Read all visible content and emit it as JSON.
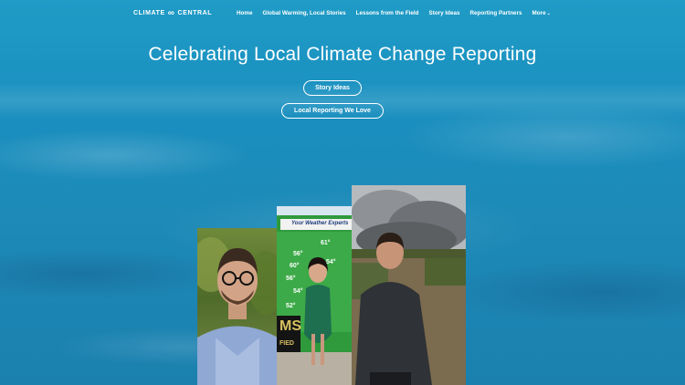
{
  "nav": {
    "logo": "CLIMATE",
    "logo_mark": "∞",
    "logo_2": "CENTRAL",
    "items": [
      {
        "label": "Home"
      },
      {
        "label": "Global Warming, Local Stories"
      },
      {
        "label": "Lessons from the Field"
      },
      {
        "label": "Story Ideas"
      },
      {
        "label": "Reporting Partners"
      },
      {
        "label": "More"
      }
    ]
  },
  "hero": {
    "title": "Celebrating Local Climate Change Reporting",
    "button_story_ideas": "Story Ideas",
    "button_local_reporting": "Local Reporting We Love"
  },
  "weather_board": {
    "header": "Your Weather Experts",
    "temps": [
      "61°",
      "56°",
      "60°",
      "56°",
      "54°",
      "54°",
      "52°"
    ],
    "logo_fragment": "MS",
    "logo_fragment_2": "FIED"
  }
}
